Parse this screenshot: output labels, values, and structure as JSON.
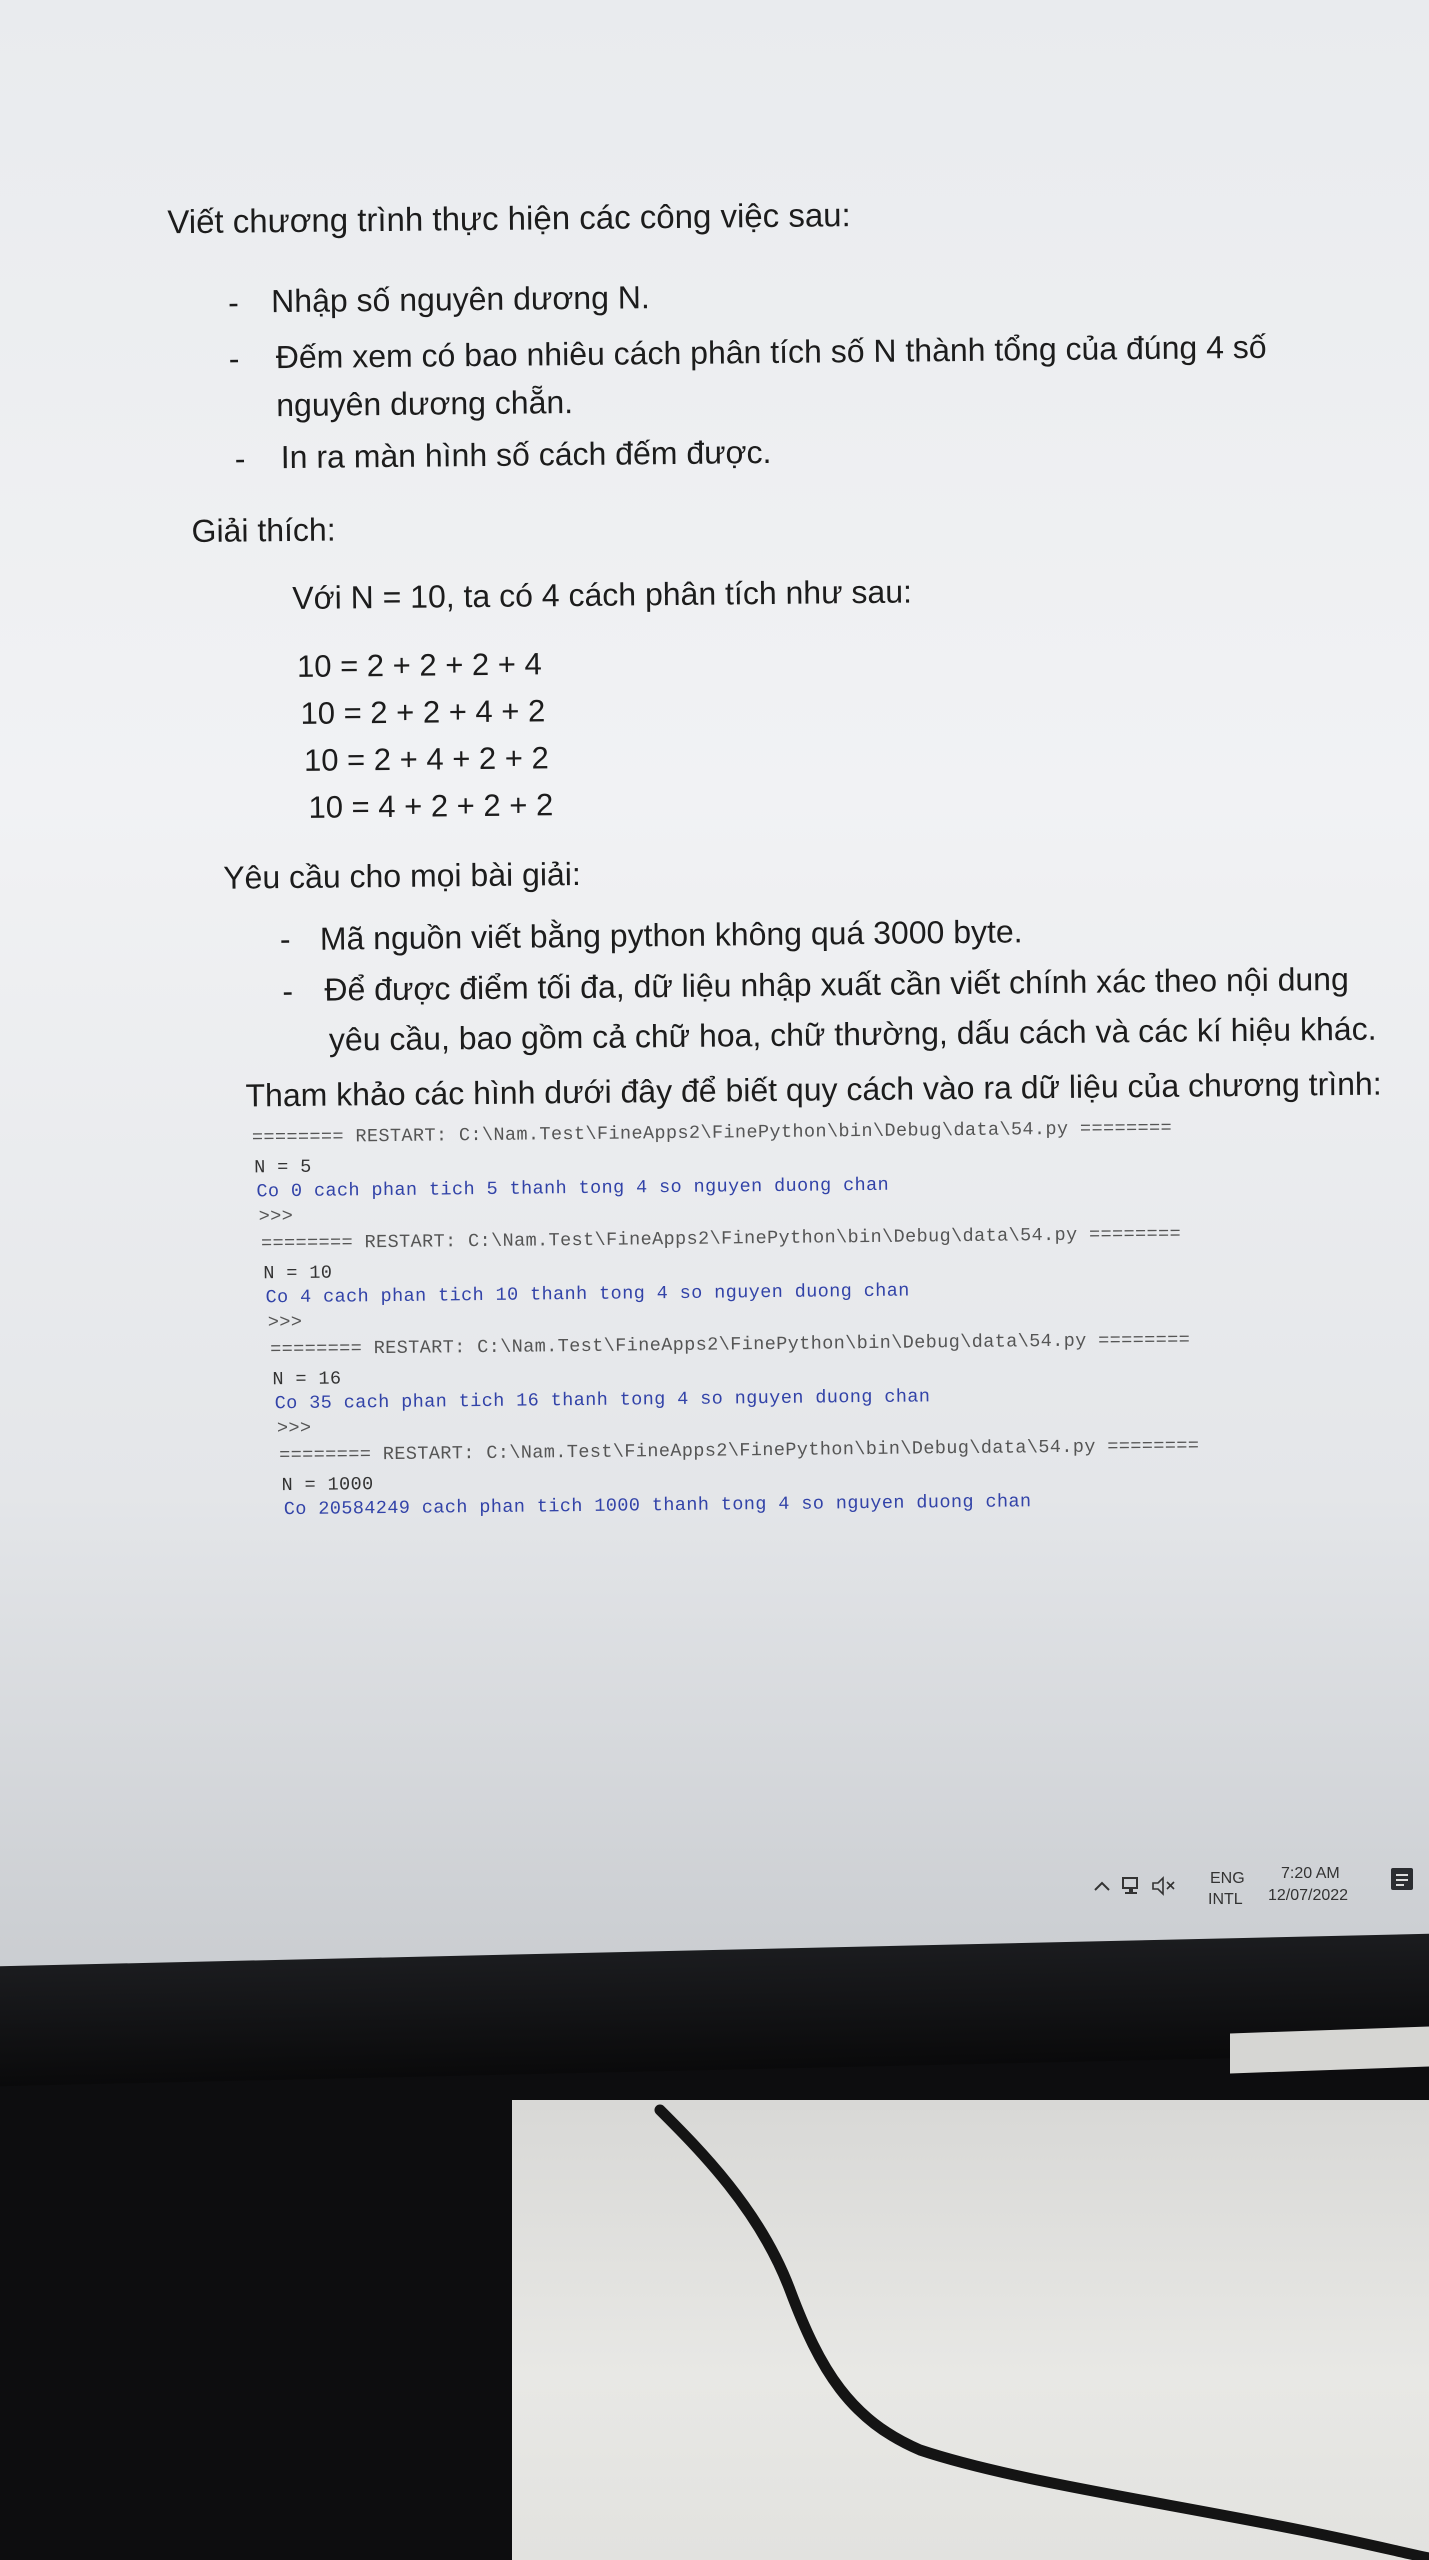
{
  "document": {
    "heading": "Viết chương trình thực hiện các công việc sau:",
    "tasks": [
      "Nhập số nguyên dương N.",
      "Đếm xem có bao nhiêu cách phân tích số N thành tổng của đúng 4 số",
      "nguyên dương chẵn.",
      "In ra màn hình số cách đếm được."
    ],
    "explain_title": "Giải thích:",
    "explain_intro": "Với N = 10, ta có 4 cách phân tích như sau:",
    "equations": [
      "10 = 2 + 2 + 2 + 4",
      "10 = 2 + 2 + 4 + 2",
      "10 = 2 + 4 + 2 + 2",
      "10 = 4 + 2 + 2 + 2"
    ],
    "requirements_title": "Yêu cầu cho mọi bài giải:",
    "requirements": [
      "Mã nguồn viết bằng python không quá 3000 byte.",
      "Để được điểm tối đa, dữ liệu nhập xuất cần viết chính xác theo nội dung",
      "yêu cầu, bao gồm cả chữ hoa, chữ thường, dấu cách và các kí hiệu khác."
    ],
    "reference": "Tham khảo các hình dưới đây để biết quy cách vào ra dữ liệu của chương trình:"
  },
  "console": {
    "restart_line": "======== RESTART: C:\\Nam.Test\\FineApps2\\FinePython\\bin\\Debug\\data\\54.py ========",
    "prompt": ">>>",
    "runs": [
      {
        "input": "N = 5",
        "output": "Co 0 cach phan tich 5 thanh tong 4 so nguyen duong chan"
      },
      {
        "input": "N = 10",
        "output": "Co 4 cach phan tich 10 thanh tong 4 so nguyen duong chan"
      },
      {
        "input": "N = 16",
        "output": "Co 35 cach phan tich 16 thanh tong 4 so nguyen duong chan"
      },
      {
        "input": "N = 1000",
        "output": "Co 20584249 cach phan tich 1000 thanh tong 4 so nguyen duong chan"
      }
    ]
  },
  "taskbar": {
    "lang_top": "ENG",
    "lang_bottom": "INTL",
    "time": "7:20 AM",
    "date": "12/07/2022"
  }
}
